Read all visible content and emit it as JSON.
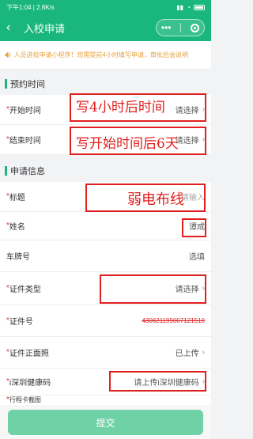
{
  "status_bar": {
    "time": "下午1:04 | 2.8K/s",
    "battery": "63"
  },
  "nav": {
    "title": "入校申请",
    "capsule_more": "•••"
  },
  "notice": {
    "text": "人员进校申请小程序！您需提前4小时填写申请，审批后会说明"
  },
  "sections": {
    "appointment": "预约时间",
    "info": "申请信息"
  },
  "fields": {
    "start_time": {
      "label": "开始时间",
      "value": "请选择"
    },
    "end_time": {
      "label": "结束时间",
      "value": "请选择"
    },
    "subject": {
      "label": "标题",
      "placeholder": "请输入"
    },
    "name": {
      "label": "姓名",
      "value": "谭成"
    },
    "plate": {
      "label": "车牌号",
      "value": "选填"
    },
    "id_type": {
      "label": "证件类型",
      "value": "请选择"
    },
    "id_number": {
      "label": "证件号",
      "value": "430621199007121510"
    },
    "id_photo": {
      "label": "证件正面照",
      "value": "已上传"
    },
    "health_code": {
      "label": "i深圳健康码",
      "value": "请上传i深圳健康码"
    },
    "partial": {
      "label": "行程卡截图"
    }
  },
  "annotations": {
    "start": "写4小时后时间",
    "end": "写开始时间后6天",
    "subject": "弱电布线"
  },
  "submit": {
    "label": "提交"
  },
  "colors": {
    "brand": "#19b77e",
    "annotation": "#e0201f",
    "notice": "#e9a23b"
  }
}
